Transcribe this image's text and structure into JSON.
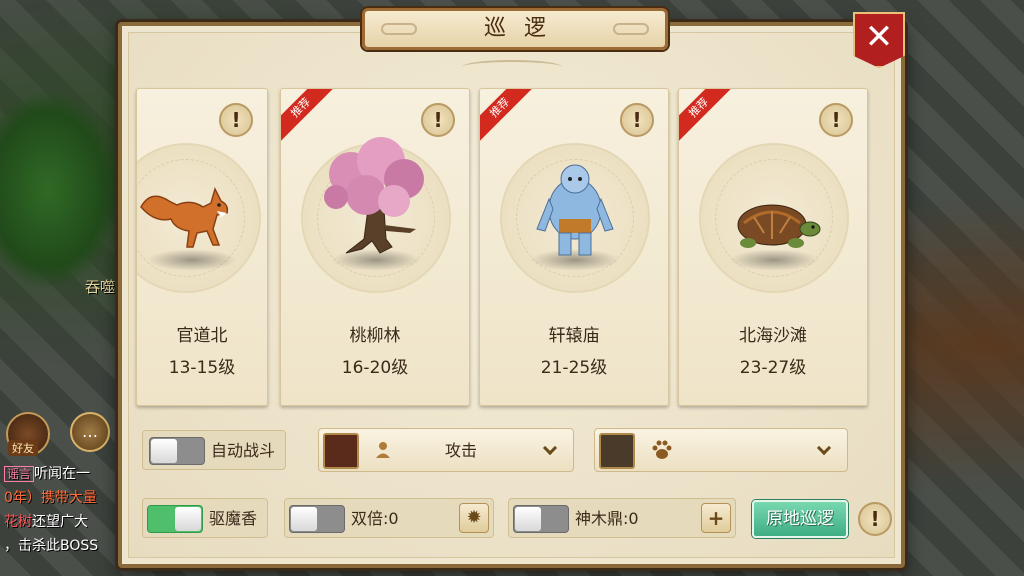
{
  "dialog": {
    "title": "巡逻",
    "close_label": "✕"
  },
  "background": {
    "side_text": "吞噬",
    "friend_label": "好友",
    "chat_icon": "…",
    "chat_lines": [
      {
        "tag": "谣言",
        "text": "听闻在一"
      },
      {
        "tag": "",
        "text": "0年）携带大量"
      },
      {
        "tag": "花树",
        "text": "还望广大"
      },
      {
        "tag": "",
        "text": "，击杀此BOSS"
      }
    ]
  },
  "cards": [
    {
      "name": "官道北",
      "level": "13-15级",
      "recommended": false,
      "monster": "fox-icon"
    },
    {
      "name": "桃柳林",
      "level": "16-20级",
      "recommended": true,
      "monster": "tree-monster-icon"
    },
    {
      "name": "轩辕庙",
      "level": "21-25级",
      "recommended": true,
      "monster": "yeti-icon"
    },
    {
      "name": "北海沙滩",
      "level": "23-27级",
      "recommended": true,
      "monster": "turtle-icon"
    }
  ],
  "badge_label": "推荐",
  "info_label": "!",
  "controls": {
    "auto_battle_label": "自动战斗",
    "auto_battle_on": false,
    "attack_label": "攻击",
    "repel_label": "驱魔香",
    "repel_on": true,
    "double_label": "双倍:0",
    "double_on": false,
    "shenmu_label": "神木鼎:0",
    "shenmu_on": false,
    "patrol_button": "原地巡逻",
    "plus_label": "+",
    "gear_label": "✹",
    "paw_icon": "paw-icon"
  },
  "colors": {
    "accent_green": "#4fbf6b",
    "ribbon_red": "#d22a1f",
    "close_red": "#b21f1f"
  }
}
